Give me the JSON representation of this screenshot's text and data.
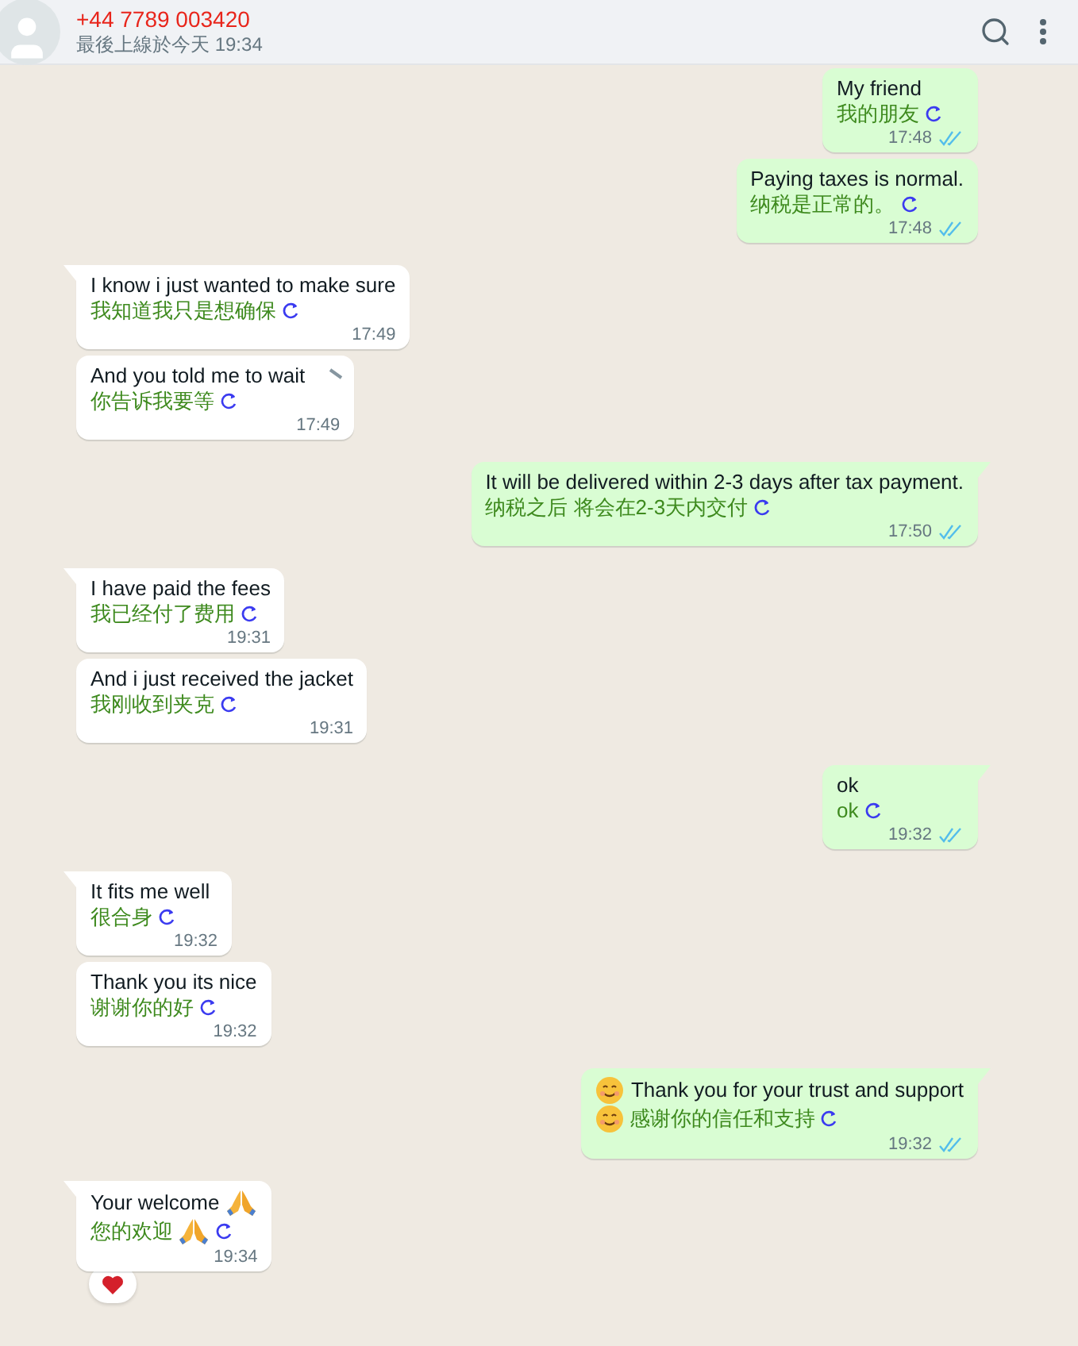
{
  "header": {
    "contact": "+44 7789 003420",
    "status": "最後上線於今天 19:34"
  },
  "messages": [
    {
      "kind": "sent",
      "tail": false,
      "text": "My friend",
      "translation": "我的朋友",
      "time": "17:48",
      "read": true
    },
    {
      "kind": "sent",
      "tail": false,
      "text": "Paying taxes is normal.",
      "translation": "纳税是正常的。",
      "time": "17:48",
      "read": true
    },
    {
      "kind": "received",
      "tail": true,
      "text": "I know i just wanted to make sure",
      "translation": "我知道我只是想确保",
      "time": "17:49"
    },
    {
      "kind": "received",
      "tail": false,
      "text": "And you told me to wait",
      "translation": "你告诉我要等",
      "time": "17:49",
      "menu_shown": true
    },
    {
      "kind": "sent",
      "tail": true,
      "text": "It will be delivered within 2-3 days after tax payment.",
      "translation": "纳税之后 将会在2-3天内交付",
      "time": "17:50",
      "read": true
    },
    {
      "kind": "received",
      "tail": true,
      "text": "I have paid the fees",
      "translation": "我已经付了费用",
      "time": "19:31"
    },
    {
      "kind": "received",
      "tail": false,
      "text": "And i just received the jacket",
      "translation": "我刚收到夹克",
      "time": "19:31"
    },
    {
      "kind": "sent",
      "tail": true,
      "text": "ok",
      "translation": "ok",
      "time": "19:32",
      "read": true
    },
    {
      "kind": "received",
      "tail": true,
      "text": "It fits me well",
      "translation": "很合身",
      "time": "19:32"
    },
    {
      "kind": "received",
      "tail": false,
      "text": "Thank you its nice",
      "translation": "谢谢你的好",
      "time": "19:32"
    },
    {
      "kind": "sent",
      "tail": true,
      "text": "Thank you for your trust and support",
      "translation": "感谢你的信任和支持",
      "time": "19:32",
      "read": true,
      "smile_emoji": true
    },
    {
      "kind": "received",
      "tail": true,
      "text": "Your welcome",
      "translation": "您的欢迎",
      "time": "19:34",
      "pray_emoji": true,
      "heart_reaction": true
    }
  ]
}
